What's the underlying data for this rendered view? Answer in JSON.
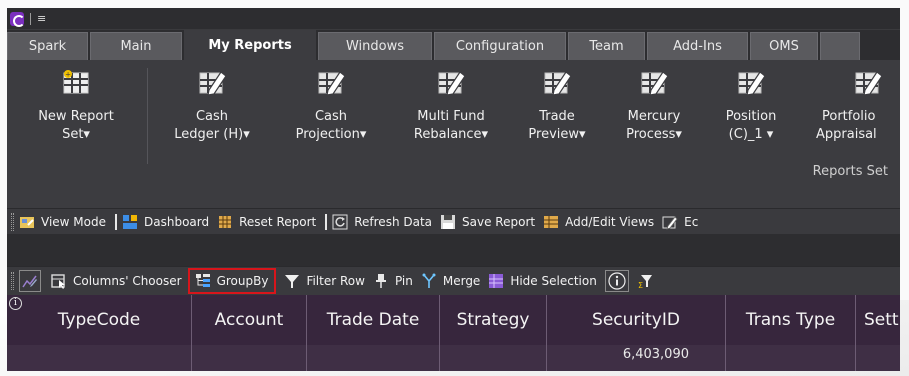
{
  "title_bar": {
    "menu_glyph": "≡"
  },
  "tabs": [
    "Spark",
    "Main",
    "My Reports",
    "Windows",
    "Configuration",
    "Team",
    "Add-Ins",
    "OMS",
    ""
  ],
  "active_tab": "My Reports",
  "ribbon": {
    "buttons": [
      {
        "line1": "New Report",
        "line2": "Set▾",
        "icon": "new-report-set-icon"
      },
      {
        "line1": "Cash",
        "line2": "Ledger (H)▾",
        "icon": "edit-report-icon"
      },
      {
        "line1": "Cash",
        "line2": "Projection▾",
        "icon": "edit-report-icon"
      },
      {
        "line1": "Multi Fund",
        "line2": "Rebalance▾",
        "icon": "edit-report-icon"
      },
      {
        "line1": "Trade",
        "line2": "Preview▾",
        "icon": "edit-report-icon"
      },
      {
        "line1": "Mercury",
        "line2": "Process▾",
        "icon": "edit-report-icon"
      },
      {
        "line1": "Position",
        "line2": "(C)_1 ▾",
        "icon": "edit-report-icon"
      },
      {
        "line1": "Portfolio",
        "line2": "Appraisal",
        "icon": "edit-report-icon"
      }
    ],
    "group_label": "Reports Set"
  },
  "toolbar1": {
    "view_mode": "View Mode",
    "dashboard": "Dashboard",
    "reset_report": "Reset Report",
    "refresh_data": "Refresh Data",
    "save_report": "Save Report",
    "add_edit_views": "Add/Edit Views",
    "edit_truncated": "Ec"
  },
  "toolbar2": {
    "columns_chooser": "Columns' Chooser",
    "group_by": "GroupBy",
    "filter_row": "Filter Row",
    "pin": "Pin",
    "merge": "Merge",
    "hide_selection": "Hide Selection"
  },
  "grid": {
    "info_glyph": "i",
    "columns": [
      "TypeCode",
      "Account",
      "Trade Date",
      "Strategy",
      "SecurityID",
      "Trans Type",
      "Settl"
    ],
    "first_row": [
      "",
      "",
      "",
      "",
      "6,403,090",
      "",
      ""
    ]
  },
  "colors": {
    "app_bg": "#2d2d30",
    "ribbon_bg": "#3c3c40",
    "grid_header": "#37263d",
    "highlight": "#d7151b"
  }
}
